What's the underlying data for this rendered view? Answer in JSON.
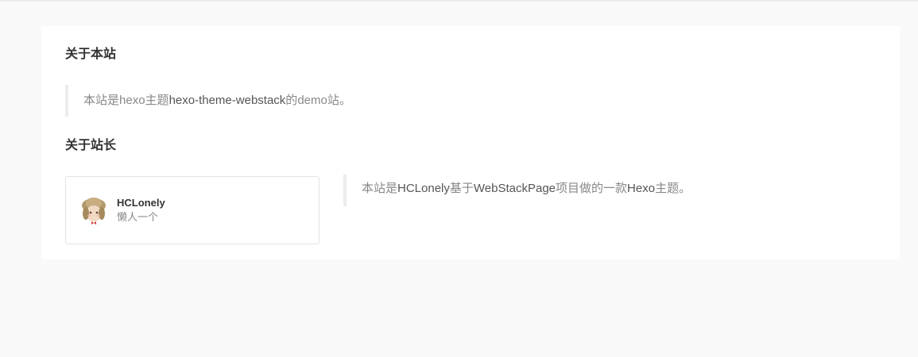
{
  "about_site": {
    "title": "关于本站",
    "quote": {
      "t1": "本站是",
      "t2": "hexo",
      "t3": "主题",
      "t4": "hexo-theme-webstack",
      "t5": "的",
      "t6": "demo",
      "t7": "站。"
    }
  },
  "about_owner": {
    "title": "关于站长",
    "card": {
      "name": "HCLonely",
      "desc": "懒人一个",
      "avatar_icon": "avatar-image"
    },
    "quote": {
      "t1": "本站是",
      "t2": "HCLonely",
      "t3": "基于",
      "t4": "WebStackPage",
      "t5": "项目做的一款",
      "t6": "Hexo",
      "t7": "主题。"
    }
  },
  "colors": {
    "page_bg": "#f9f9f9",
    "panel_bg": "#ffffff",
    "text_muted": "#888888",
    "text_emphasis": "#555555",
    "quote_border": "#ececec"
  }
}
